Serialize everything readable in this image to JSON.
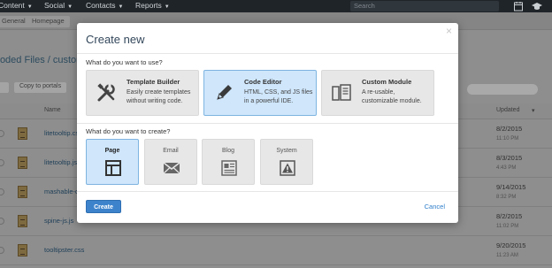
{
  "topnav": {
    "items": [
      {
        "label": "Content"
      },
      {
        "label": "Social"
      },
      {
        "label": "Contacts"
      },
      {
        "label": "Reports"
      }
    ],
    "search_placeholder": "Search",
    "icons": [
      "calendar-icon",
      "graduation-cap-icon"
    ]
  },
  "background": {
    "breadcrumbs": [
      "General",
      "Homepage"
    ],
    "page_title": "Coded Files  /  custom",
    "copy_button": "Copy to portals",
    "columns": {
      "name": "Name",
      "updated": "Updated"
    },
    "rows": [
      {
        "name": "litetooltip.css",
        "date": "8/2/2015",
        "time": "11:10 PM"
      },
      {
        "name": "litetooltip.js",
        "date": "8/3/2015",
        "time": "4:43 PM"
      },
      {
        "name": "mashable-dropdown.css",
        "date": "9/14/2015",
        "time": "8:32 PM"
      },
      {
        "name": "spine-js.js",
        "date": "8/2/2015",
        "time": "11:02 PM"
      },
      {
        "name": "tooltipster.css",
        "date": "9/20/2015",
        "time": "11:23 AM"
      }
    ]
  },
  "modal": {
    "title": "Create new",
    "close_glyph": "×",
    "question_use": "What do you want to use?",
    "tools": [
      {
        "title": "Template Builder",
        "description": "Easily create templates without writing code.",
        "icon": "tools-icon",
        "selected": false
      },
      {
        "title": "Code Editor",
        "description": "HTML, CSS, and JS files in a powerful IDE.",
        "icon": "pencil-icon",
        "selected": true
      },
      {
        "title": "Custom Module",
        "description": "A re-usable, customizable module.",
        "icon": "module-icon",
        "selected": false
      }
    ],
    "question_create": "What do you want to create?",
    "content_types": [
      {
        "label": "Page",
        "icon": "page-layout-icon",
        "selected": true
      },
      {
        "label": "Email",
        "icon": "envelope-icon",
        "selected": false
      },
      {
        "label": "Blog",
        "icon": "blog-icon",
        "selected": false
      },
      {
        "label": "System",
        "icon": "warning-icon",
        "selected": false
      }
    ],
    "create_button": "Create",
    "cancel_link": "Cancel"
  },
  "colors": {
    "accent": "#3d83cc",
    "selected_fill": "#cfe6fb",
    "link": "#2f7ecb"
  }
}
